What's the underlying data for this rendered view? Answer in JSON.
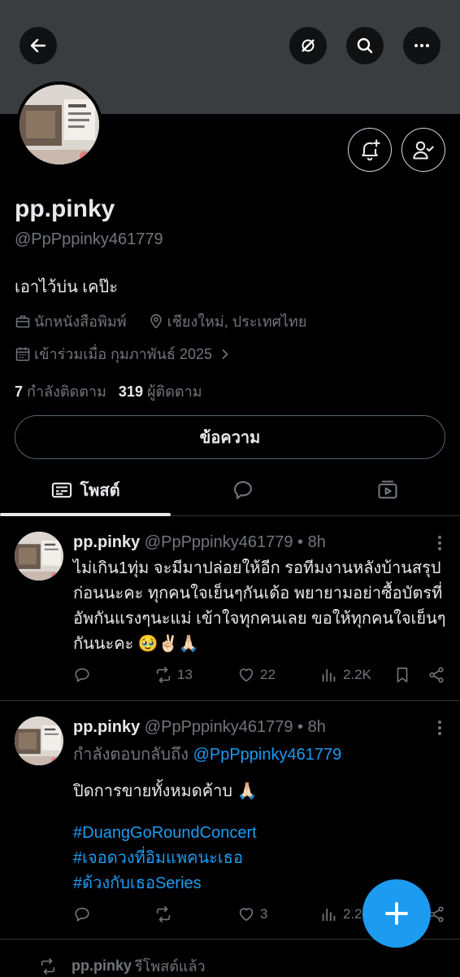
{
  "profile": {
    "name": "pp.pinky",
    "handle": "@PpPppinky461779",
    "bio": "เอาไว้บ่น เคป๊ะ",
    "job": "นักหนังสือพิมพ์",
    "location": "เชียงใหม่, ประเทศไทย",
    "joined": "เข้าร่วมเมื่อ กุมภาพันธ์ 2025",
    "following_count": "7",
    "following_label": "กำลังติดตาม",
    "followers_count": "319",
    "followers_label": "ผู้ติดตาม",
    "message_button": "ข้อความ"
  },
  "tabs": {
    "posts_label": "โพสต์"
  },
  "posts": [
    {
      "name": "pp.pinky",
      "handle": "@PpPppinky461779 • 8h",
      "text": "ไม่เกิน1ทุ่ม จะมีมาปล่อยให้อีก รอทีมงานหลังบ้านสรุปก่อนนะคะ ทุกคนใจเย็นๆกันเด้อ พยายามอย่าซื้อบัตรที่อัพกันแรงๆนะแม่ เข้าใจทุกคนเลย ขอให้ทุกคนใจเย็นๆกันนะคะ 🥹✌🏻🙏🏻",
      "reposts": "13",
      "likes": "22",
      "views": "2.2K"
    },
    {
      "name": "pp.pinky",
      "handle": "@PpPppinky461779 • 8h",
      "reply_prefix": "กำลังตอบกลับถึง",
      "reply_to": "@PpPppinky461779",
      "text": "ปิดการขายทั้งหมดค้าบ 🙏🏻",
      "hashtags": [
        "#DuangGoRoundConcert",
        "#เจอดวงที่อิมแพคนะเธอ",
        "#ด้วงกับเธอSeries"
      ],
      "likes": "3",
      "views": "2.2"
    }
  ],
  "repost_notice": {
    "name": "pp.pinky",
    "label": "รีโพสต์แล้ว"
  },
  "colors": {
    "accent": "#1d9bf0",
    "background": "#000000",
    "banner": "#3a3d40",
    "muted": "#71767b"
  }
}
